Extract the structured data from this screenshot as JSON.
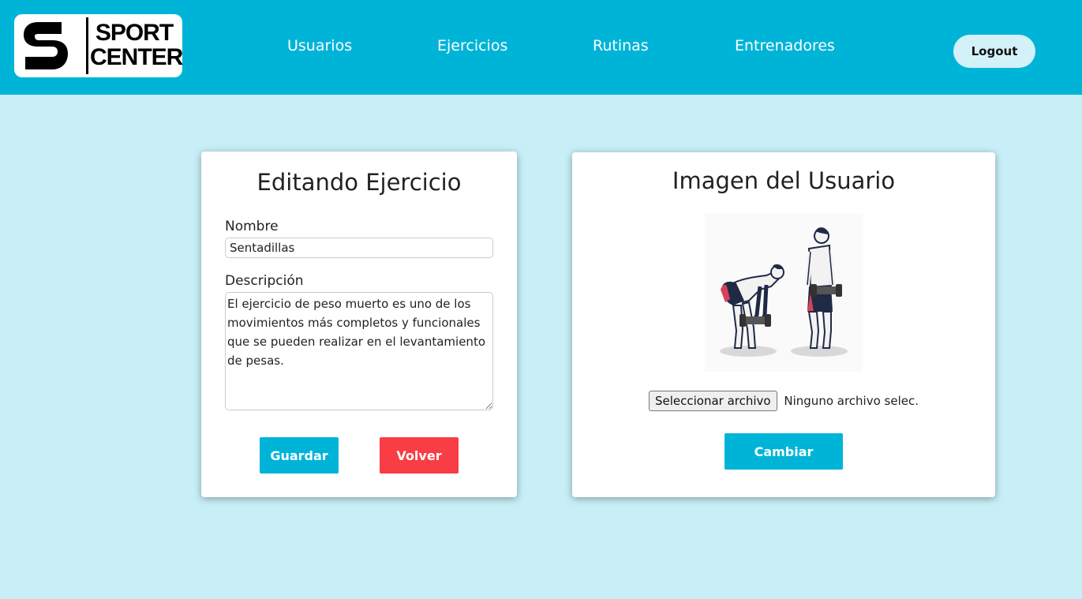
{
  "brand": {
    "line1": "SPORT",
    "line2": "CENTER"
  },
  "nav": {
    "items": [
      {
        "label": "Usuarios"
      },
      {
        "label": "Ejercicios"
      },
      {
        "label": "Rutinas"
      },
      {
        "label": "Entrenadores"
      }
    ],
    "logout_label": "Logout"
  },
  "edit_form": {
    "title": "Editando Ejercicio",
    "name_label": "Nombre",
    "name_value": "Sentadillas",
    "description_label": "Descripción",
    "description_value": "El ejercicio de peso muerto es uno de los movimientos más completos y funcionales que se pueden realizar en el levantamiento de pesas.",
    "save_label": "Guardar",
    "back_label": "Volver"
  },
  "image_panel": {
    "title": "Imagen del Usuario",
    "image_icon": "deadlift-illustration",
    "file_button_label": "Seleccionar archivo",
    "file_status": "Ninguno archivo selec.",
    "change_label": "Cambiar"
  },
  "colors": {
    "navbar": "#00b4d8",
    "background": "#c8eff7",
    "primary_button": "#00b4d8",
    "danger_button": "#f93d44"
  }
}
